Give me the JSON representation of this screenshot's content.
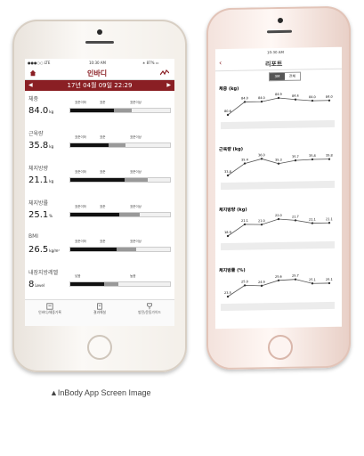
{
  "left_app": {
    "status_left": "●●●○○ LTE",
    "status_time": "10:30 AM",
    "status_right": "∗ 87% ▭",
    "title": "인바디",
    "date": "17년 04월 09일 22:29",
    "rows": [
      {
        "label": "체중",
        "value": "84.0",
        "unit": "kg",
        "scale": [
          "표준이하",
          "표준",
          "표준이상"
        ],
        "level": 0.62
      },
      {
        "label": "근육량",
        "value": "35.8",
        "unit": "kg",
        "scale": [
          "표준이하",
          "표준",
          "표준이상"
        ],
        "level": 0.55
      },
      {
        "label": "체지방량",
        "value": "21.1",
        "unit": "kg",
        "scale": [
          "표준이하",
          "표준",
          "표준이상"
        ],
        "level": 0.78
      },
      {
        "label": "체지방률",
        "value": "25.1",
        "unit": "%",
        "scale": [
          "표준이하",
          "표준",
          "표준이상"
        ],
        "level": 0.7
      },
      {
        "label": "BMI",
        "value": "26.5",
        "unit": "kg/m²",
        "scale": [
          "표준이하",
          "표준",
          "표준이상"
        ],
        "level": 0.66
      },
      {
        "label": "내장지방레벨",
        "value": "8",
        "unit": "Level",
        "scale": [
          "낮음",
          "",
          "높음"
        ],
        "level": 0.48
      }
    ],
    "tabs": [
      "인바디/체중기록",
      "결과해설",
      "방전/운동가이드"
    ]
  },
  "right_app": {
    "status_time": "10:30 AM",
    "title": "리포트",
    "toggle": [
      "3M",
      "전체"
    ],
    "sections": [
      {
        "label": "체중 (kg)",
        "values": [
          "80.6",
          "84.0",
          "84.0",
          "84.9",
          "84.4",
          "84.0",
          "84.0"
        ]
      },
      {
        "label": "근육량 (kg)",
        "values": [
          "33.8",
          "35.4",
          "36.0",
          "35.3",
          "35.7",
          "35.8",
          "35.8"
        ]
      },
      {
        "label": "체지방량 (kg)",
        "values": [
          "18.9",
          "21.1",
          "21.0",
          "22.0",
          "21.7",
          "21.1",
          "21.1"
        ]
      },
      {
        "label": "체지방률 (%)",
        "values": [
          "23.5",
          "25.0",
          "24.9",
          "25.6",
          "25.7",
          "25.1",
          "25.1"
        ]
      }
    ]
  },
  "caption": "▲InBody App Screen Image"
}
